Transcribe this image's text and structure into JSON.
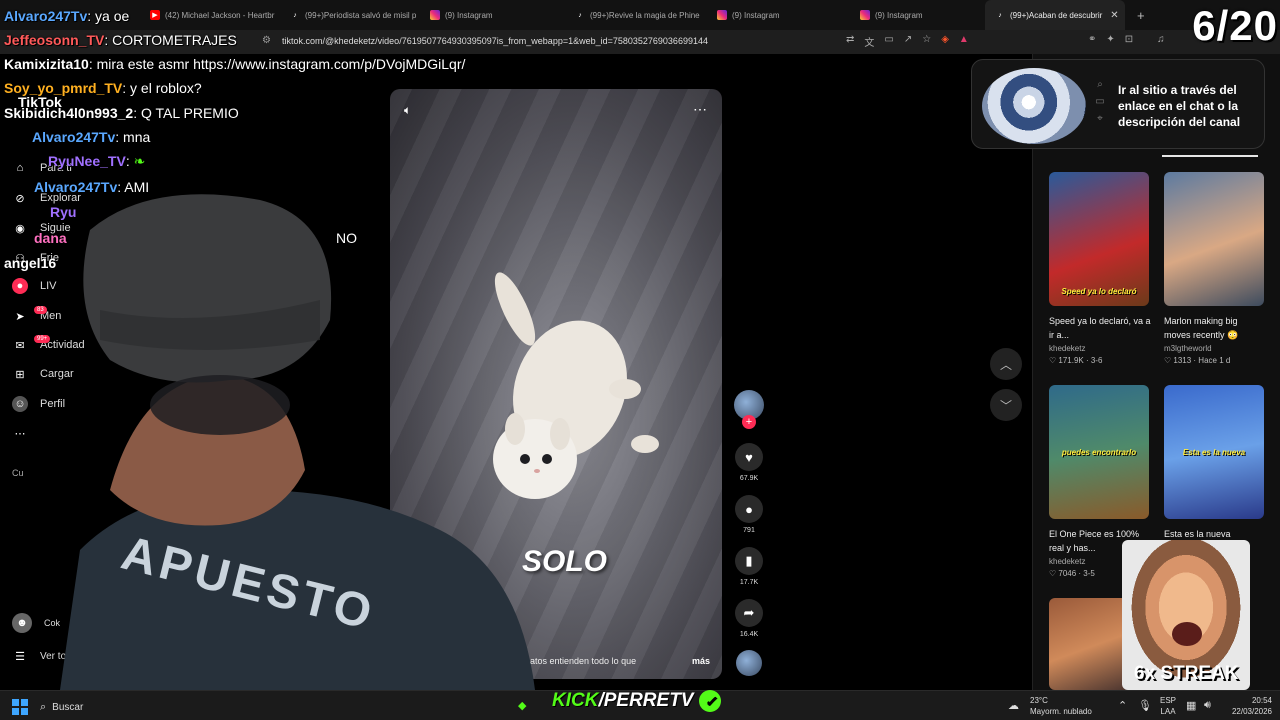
{
  "browser": {
    "tabs": [
      {
        "label": "(42) Michael Jackson - Heartbr",
        "fav": "youtube"
      },
      {
        "label": "(99+)Periodista salvó de misil p",
        "fav": "tiktok"
      },
      {
        "label": "(9) Instagram",
        "fav": "instagram"
      },
      {
        "label": "(99+)Revive la magia de Phine",
        "fav": "tiktok"
      },
      {
        "label": "(9) Instagram",
        "fav": "instagram"
      },
      {
        "label": "(9) Instagram",
        "fav": "instagram"
      },
      {
        "label": "(99+)Acaban de descubrir",
        "fav": "tiktok",
        "active": true
      }
    ],
    "new_tab": "+",
    "url": "tiktok.com/@khedeketz/video/7619507764930395097is_from_webapp=1&web_id=7580352769036699144"
  },
  "overlay": {
    "counter": "6/20",
    "streak": "6x STREAK",
    "kick_prefix": "KICK",
    "kick_suffix": "/PERRETV"
  },
  "chat": [
    {
      "user": "Alvaro247Tv",
      "text": ": ya oe",
      "color": "#5aa8ff"
    },
    {
      "user": "Jeffeosonn_TV",
      "text": ": CORTOMETRAJES",
      "color": "#ff5a5a"
    },
    {
      "user": "Kamixizita10",
      "text": ": mira este asmr https://www.instagram.com/p/DVojMDGiLqr/",
      "color": "#ffffff"
    },
    {
      "user": "Soy_yo_pmrd_TV",
      "text": ": y el roblox?",
      "color": "#ffb020"
    },
    {
      "user": "Skibidich4l0n993_2",
      "text": ": Q TAL PREMIO",
      "color": "#ffffff"
    },
    {
      "user": "Alvaro247Tv",
      "text": ": mna",
      "color": "#5aa8ff"
    },
    {
      "user": "RyuNee_TV",
      "text": ": ",
      "color": "#a070ff"
    },
    {
      "user": "Alvaro247Tv",
      "text": ": AMI",
      "color": "#5aa8ff"
    },
    {
      "user": "Ryu",
      "text": "",
      "color": "#a070ff"
    },
    {
      "user": "dana",
      "text": "",
      "color": "#ff70c0"
    },
    {
      "user": "angel16",
      "text": "",
      "color": "#ffffff"
    }
  ],
  "chat_fragment": "NO",
  "tiktok": {
    "logo": "TikTok",
    "nav": [
      {
        "label": "Para ti",
        "icon": "home-icon"
      },
      {
        "label": "Explorar",
        "icon": "compass-icon"
      },
      {
        "label": "Siguie",
        "icon": "following-icon"
      },
      {
        "label": "Frie",
        "icon": "friends-icon"
      },
      {
        "label": "LIV",
        "icon": "live-icon"
      },
      {
        "label": "Men",
        "icon": "send-icon",
        "badge": "83"
      },
      {
        "label": "Actividad",
        "icon": "activity-icon",
        "badge": "99+"
      },
      {
        "label": "Cargar",
        "icon": "upload-icon"
      },
      {
        "label": "Perfil",
        "icon": "profile-icon"
      },
      {
        "label": "Cu",
        "icon": "more-icon"
      },
      {
        "label": "Cok",
        "icon": "avatar-icon"
      },
      {
        "label": "Ver todo",
        "icon": "see-all-icon"
      }
    ],
    "video": {
      "caption_big": "SOLO",
      "caption_small": "atos entienden todo lo que",
      "more": "más",
      "author_frag": "eke"
    },
    "actions": {
      "likes": "67.9K",
      "comments": "791",
      "saves": "17.7K",
      "shares": "16.4K"
    },
    "promo": "Ir al sitio a través del enlace en el chat o la descripción del canal",
    "cards": [
      {
        "tag": "Speed ya lo declaró",
        "title": "Speed ya lo declaró, va a ir a...",
        "author": "khedeketz",
        "meta": "♡ 171.9K · 3-6",
        "bg": "linear-gradient(160deg,#2a5a9a,#c22a2a 60%,#6b3a1a)"
      },
      {
        "tag": "",
        "title": "Marlon making big moves recently 😳",
        "author": "m3lgtheworld",
        "meta": "♡ 1313 · Hace 1 d",
        "bg": "linear-gradient(160deg,#5c7aa0,#d9a884 55%,#3d4b5e)"
      },
      {
        "tag": "puedes encontrarlo",
        "title": "El One Piece es 100% real y has...",
        "author": "khedeketz",
        "meta": "♡ 7046 · 3-5",
        "bg": "linear-gradient(170deg,#2f6a8a,#4f8a6a 50%,#8a5a2a)"
      },
      {
        "tag": "Esta es la nueva",
        "title": "Esta es la nueva",
        "author": "",
        "meta": "",
        "bg": "linear-gradient(170deg,#3a6acc,#6aa0e8 50%,#2a3a8a)"
      },
      {
        "tag": "",
        "title": "",
        "author": "",
        "meta": "",
        "bg": "linear-gradient(160deg,#9a5a3a,#d08a5a 50%,#3a2a2a)"
      }
    ]
  },
  "taskbar": {
    "search": "Buscar",
    "weather_temp": "23°C",
    "weather_desc": "Mayorm. nublado",
    "lang1": "ESP",
    "lang2": "LAA",
    "time": "20:54",
    "date": "22/03/2026"
  },
  "colors": {
    "tiktok_red": "#fe2c55",
    "kick_green": "#53fc18"
  }
}
